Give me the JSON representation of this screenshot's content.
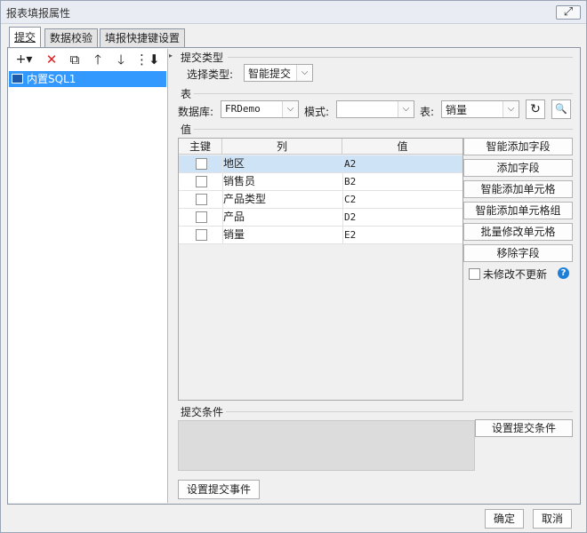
{
  "window": {
    "title": "报表填报属性",
    "close_glyph": "⤢"
  },
  "tabs": [
    {
      "label": "提交",
      "active": true
    },
    {
      "label": "数据校验",
      "active": false
    },
    {
      "label": "填报快捷键设置",
      "active": false
    }
  ],
  "toolbar": {
    "add_glyph": "+▾",
    "delete_glyph": "✕",
    "copy_glyph": "⧉",
    "up_glyph": "🡑",
    "down_glyph": "🡓",
    "sort_glyph": "⋮⬇",
    "icons": [
      "add-icon",
      "delete-icon",
      "copy-icon",
      "move-up-icon",
      "move-down-icon",
      "sort-icon"
    ],
    "delete_color": "#e02020"
  },
  "tree": {
    "items": [
      {
        "label": "内置SQL1",
        "selected": true
      }
    ]
  },
  "submit_type": {
    "section_title": "提交类型",
    "label": "选择类型:",
    "value": "智能提交"
  },
  "table_section": {
    "section_title": "表",
    "database_label": "数据库:",
    "database_value": "FRDemo",
    "mode_label": "模式:",
    "mode_value": "",
    "table_label": "表:",
    "table_value": "销量",
    "refresh_glyph": "↻",
    "preview_glyph": "🔍"
  },
  "value_section": {
    "section_title": "值",
    "headers": {
      "key": "主键",
      "column": "列",
      "value": "值"
    },
    "rows": [
      {
        "key": false,
        "column": "地区",
        "value": "A2",
        "selected": true
      },
      {
        "key": false,
        "column": "销售员",
        "value": "B2",
        "selected": false
      },
      {
        "key": false,
        "column": "产品类型",
        "value": "C2",
        "selected": false
      },
      {
        "key": false,
        "column": "产品",
        "value": "D2",
        "selected": false
      },
      {
        "key": false,
        "column": "销量",
        "value": "E2",
        "selected": false
      }
    ],
    "buttons": {
      "smart_add_field": "智能添加字段",
      "add_field": "添加字段",
      "smart_add_cell": "智能添加单元格",
      "smart_add_cell_group": "智能添加单元格组",
      "batch_modify_cell": "批量修改单元格",
      "remove_field": "移除字段"
    },
    "no_update_unmodified": {
      "label": "未修改不更新",
      "checked": false
    },
    "help_glyph": "?",
    "help_color": "#1e7fd6"
  },
  "submit_condition": {
    "section_title": "提交条件",
    "set_button": "设置提交条件"
  },
  "submit_event_button": "设置提交事件",
  "footer": {
    "ok": "确定",
    "cancel": "取消"
  },
  "colors": {
    "selection": "#3399ff",
    "row_selection": "#cfe3f7"
  }
}
